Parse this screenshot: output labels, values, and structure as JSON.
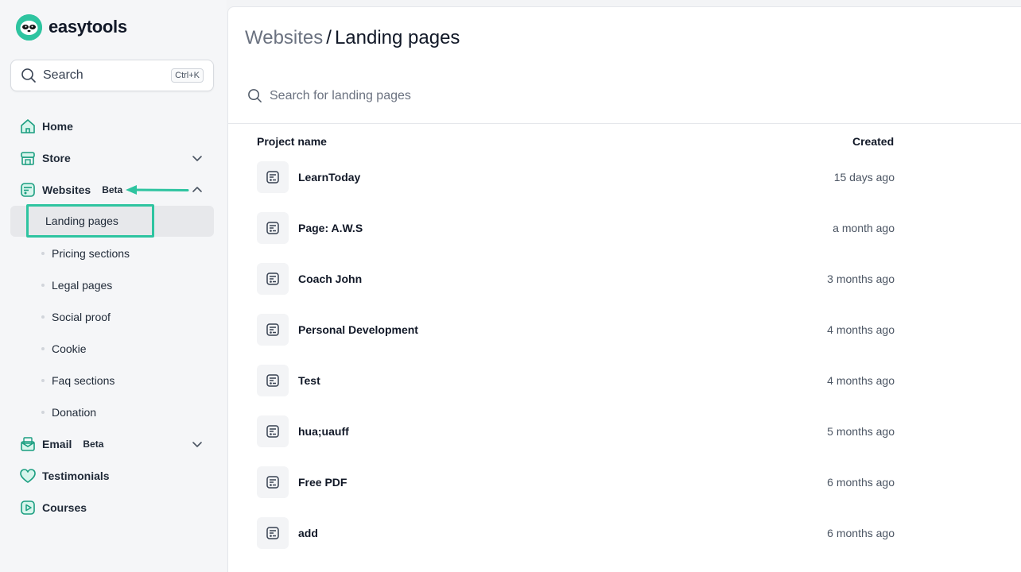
{
  "brand": {
    "name": "easytools",
    "accent": "#2ec4a0"
  },
  "search": {
    "label": "Search",
    "shortcut": "Ctrl+K"
  },
  "nav": {
    "home": "Home",
    "store": "Store",
    "websites": "Websites",
    "websites_badge": "Beta",
    "email": "Email",
    "email_badge": "Beta",
    "testimonials": "Testimonials",
    "courses": "Courses"
  },
  "websites_sub": {
    "active": "Landing pages",
    "items": [
      "Pricing sections",
      "Legal pages",
      "Social proof",
      "Cookie",
      "Faq sections",
      "Donation"
    ]
  },
  "main": {
    "breadcrumb_parent": "Websites",
    "breadcrumb_sep": "/",
    "title": "Landing pages",
    "search_placeholder": "Search for landing pages",
    "col_name": "Project name",
    "col_created": "Created",
    "rows": [
      {
        "name": "LearnToday",
        "created": "15 days ago"
      },
      {
        "name": "Page: A.W.S",
        "created": "a month ago"
      },
      {
        "name": "Coach John",
        "created": "3 months ago"
      },
      {
        "name": "Personal Development",
        "created": "4 months ago"
      },
      {
        "name": "Test",
        "created": "4 months ago"
      },
      {
        "name": "hua;uauff",
        "created": "5 months ago"
      },
      {
        "name": "Free PDF",
        "created": "6 months ago"
      },
      {
        "name": "add",
        "created": "6 months ago"
      }
    ]
  }
}
